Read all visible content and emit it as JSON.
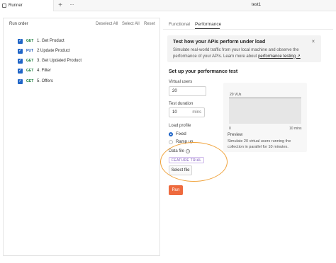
{
  "titlebar": {
    "tab_label": "Runner",
    "plus_label": "+",
    "more_label": "···",
    "window_title": "test1"
  },
  "run_order": {
    "label": "Run order",
    "deselect_all": "Deselect All",
    "select_all": "Select All",
    "reset": "Reset",
    "requests": [
      {
        "method": "GET",
        "name": "1. Get Product",
        "checked": true
      },
      {
        "method": "PUT",
        "name": "2.Update Product",
        "checked": true
      },
      {
        "method": "GET",
        "name": "3. Get Updated Product",
        "checked": true
      },
      {
        "method": "GET",
        "name": "4. Filter",
        "checked": true
      },
      {
        "method": "GET",
        "name": "5. Offers",
        "checked": true
      }
    ]
  },
  "tabs": {
    "functional": "Functional",
    "performance": "Performance",
    "active": "Performance"
  },
  "banner": {
    "title": "Test how your APIs perform under load",
    "text_before_link": "Simulate real-world traffic from your local machine and observe the performance of your APIs. Learn more about ",
    "link": "performance testing ↗"
  },
  "setup": {
    "title": "Set up your performance test",
    "virtual_users_label": "Virtual users",
    "virtual_users_value": "20",
    "test_duration_label": "Test duration",
    "test_duration_value": "10",
    "test_duration_unit": "mins",
    "load_profile_label": "Load profile",
    "load_profile_options": [
      "Fixed",
      "Ramp up"
    ],
    "load_profile_selected": "Fixed",
    "data_file_label": "Data file",
    "feature_badge": "FEATURE TRIAL",
    "select_file_label": "Select file",
    "run_label": "Run"
  },
  "preview": {
    "vu_tag": "20 VUs",
    "x_start": "0",
    "x_end": "10 mins",
    "title": "Preview",
    "text": "Simulate 20 virtual users running the collection in parallel for 10 minutes."
  },
  "colors": {
    "accent": "#1f65c7",
    "run_button": "#ee6a3e",
    "highlight": "#f0a23a",
    "get_method": "#1a7d3e",
    "put_method": "#1f5ab8"
  }
}
